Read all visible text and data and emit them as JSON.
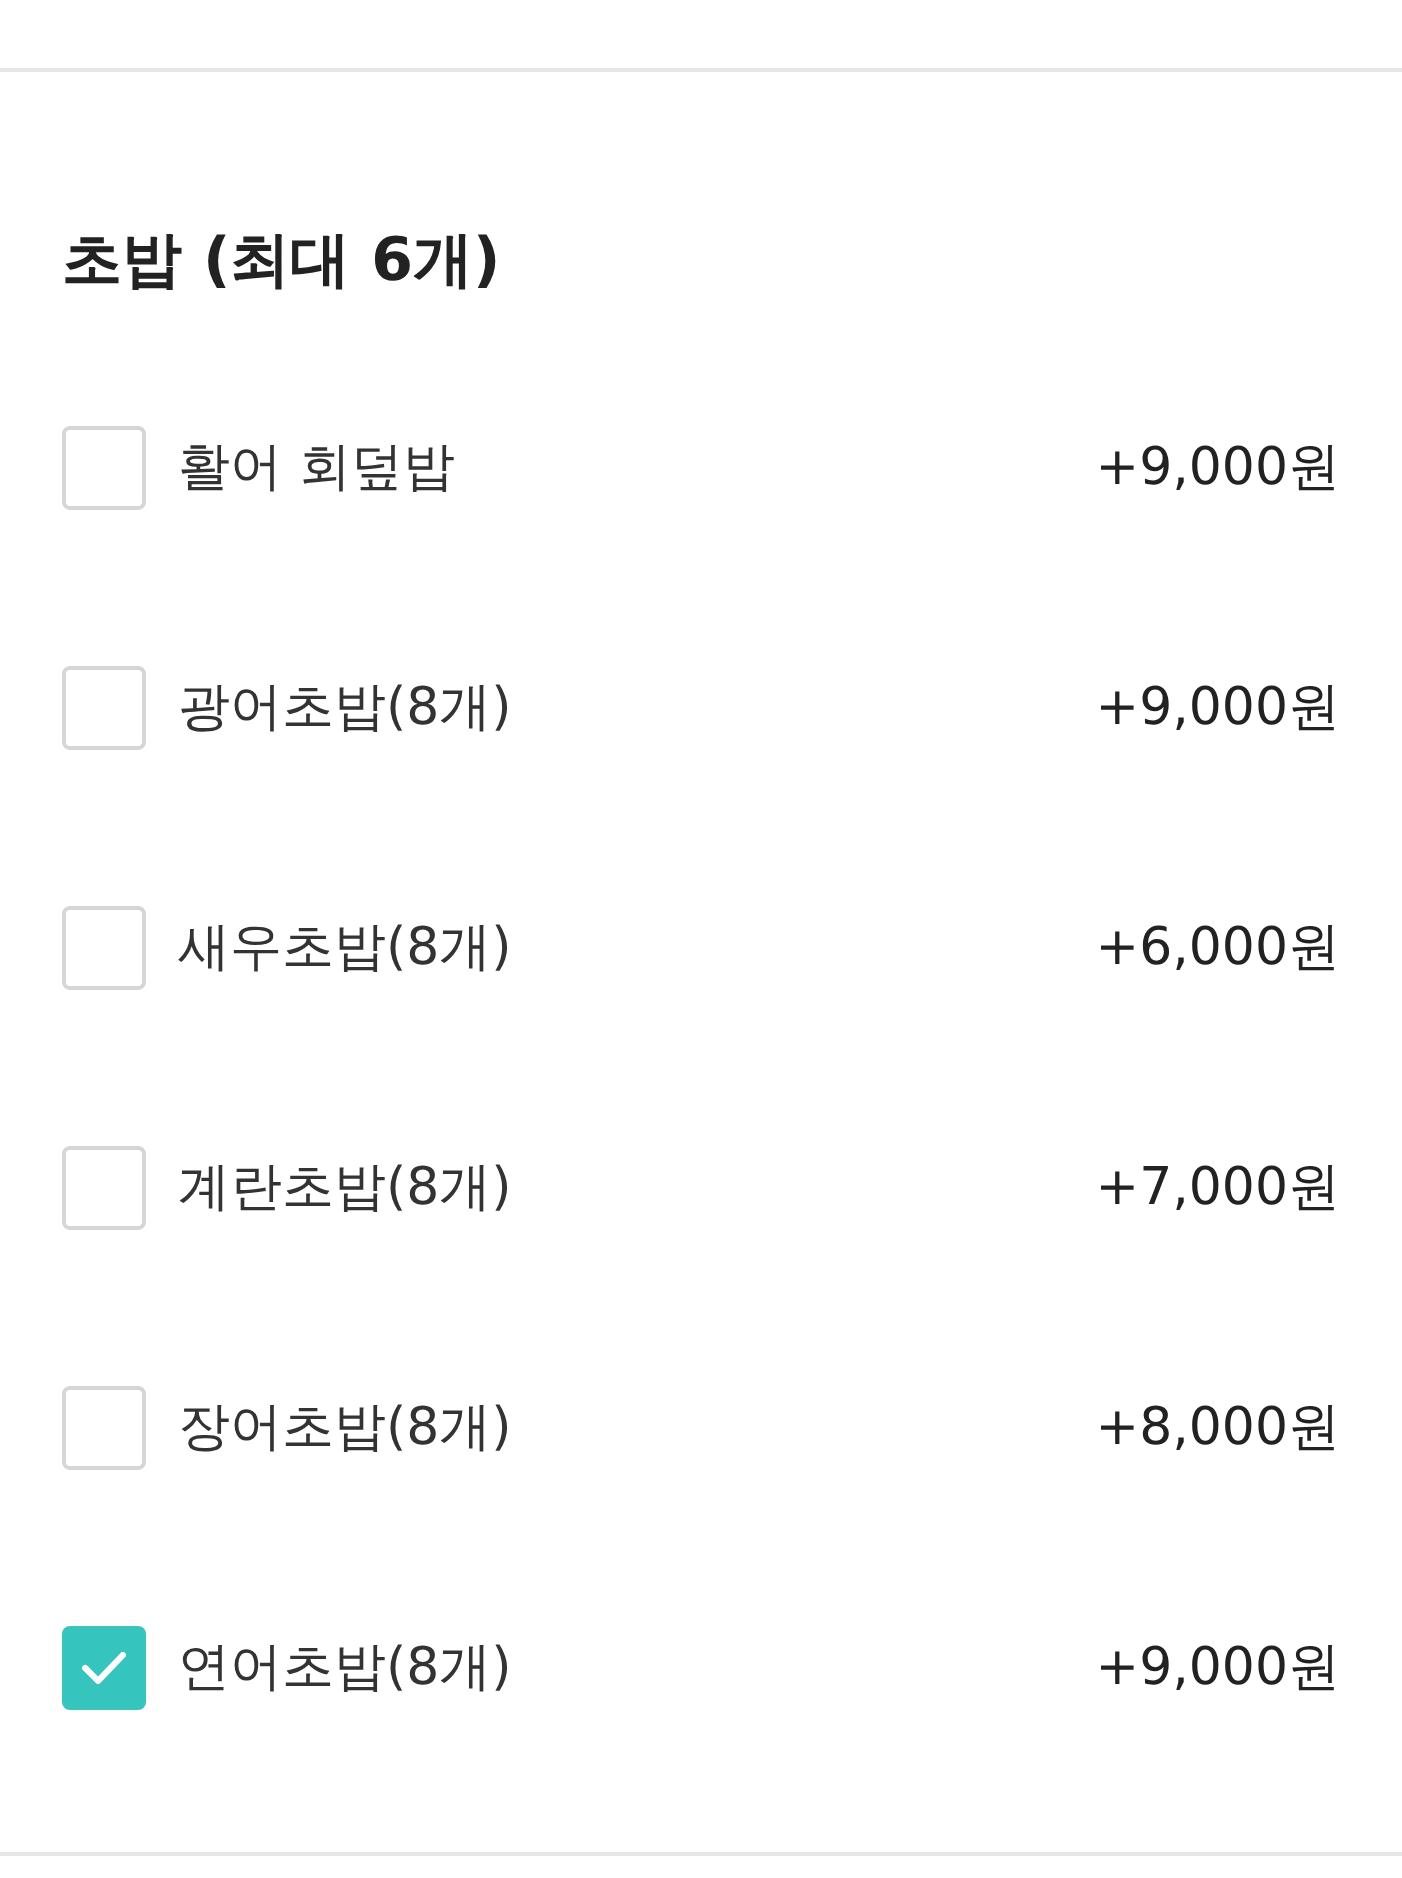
{
  "section": {
    "title": "초밥 (최대 6개)"
  },
  "options": [
    {
      "label": "활어 회덮밥",
      "price": "+9,000원",
      "checked": false
    },
    {
      "label": "광어초밥(8개)",
      "price": "+9,000원",
      "checked": false
    },
    {
      "label": "새우초밥(8개)",
      "price": "+6,000원",
      "checked": false
    },
    {
      "label": "계란초밥(8개)",
      "price": "+7,000원",
      "checked": false
    },
    {
      "label": "장어초밥(8개)",
      "price": "+8,000원",
      "checked": false
    },
    {
      "label": "연어초밥(8개)",
      "price": "+9,000원",
      "checked": true
    }
  ]
}
